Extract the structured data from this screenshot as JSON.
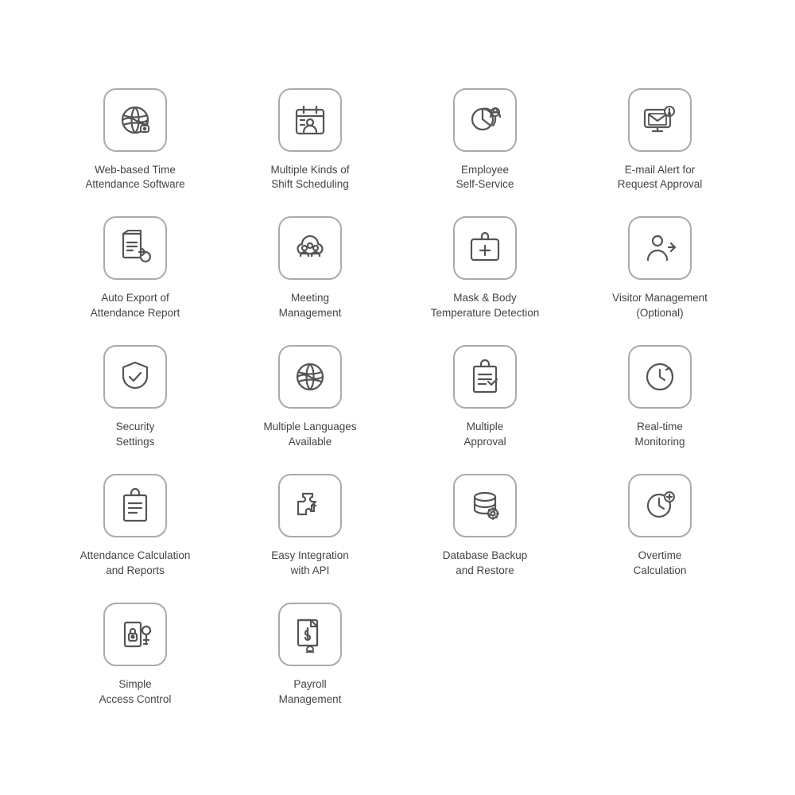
{
  "features": [
    {
      "id": "web-based-time",
      "label": "Web-based Time\nAttendance Software",
      "icon": "globe-lock"
    },
    {
      "id": "multiple-shift",
      "label": "Multiple Kinds of\nShift Scheduling",
      "icon": "calendar-lines"
    },
    {
      "id": "employee-self",
      "label": "Employee\nSelf-Service",
      "icon": "person-chart"
    },
    {
      "id": "email-alert",
      "label": "E-mail Alert for\nRequest Approval",
      "icon": "email-monitor"
    },
    {
      "id": "auto-export",
      "label": "Auto Export of\nAttendance Report",
      "icon": "report-export"
    },
    {
      "id": "meeting-mgmt",
      "label": "Meeting\nManagement",
      "icon": "people-cloud"
    },
    {
      "id": "mask-body",
      "label": "Mask & Body\nTemperature Detection",
      "icon": "medical-box"
    },
    {
      "id": "visitor-mgmt",
      "label": "Visitor Management\n(Optional)",
      "icon": "person-arrow"
    },
    {
      "id": "security-settings",
      "label": "Security\nSettings",
      "icon": "shield-check"
    },
    {
      "id": "multi-lang",
      "label": "Multiple Languages\nAvailable",
      "icon": "globe-lines"
    },
    {
      "id": "multi-approval",
      "label": "Multiple\nApproval",
      "icon": "list-check"
    },
    {
      "id": "realtime-monitor",
      "label": "Real-time\nMonitoring",
      "icon": "clock-arrow"
    },
    {
      "id": "attendance-calc",
      "label": "Attendance Calculation\nand Reports",
      "icon": "clipboard-list"
    },
    {
      "id": "easy-integration",
      "label": "Easy Integration\nwith API",
      "icon": "puzzle-arrows"
    },
    {
      "id": "database-backup",
      "label": "Database Backup\nand Restore",
      "icon": "database-gear"
    },
    {
      "id": "overtime-calc",
      "label": "Overtime\nCalculation",
      "icon": "clock-plus"
    },
    {
      "id": "simple-access",
      "label": "Simple\nAccess Control",
      "icon": "key-card"
    },
    {
      "id": "payroll-mgmt",
      "label": "Payroll\nManagement",
      "icon": "dollar-person"
    }
  ]
}
